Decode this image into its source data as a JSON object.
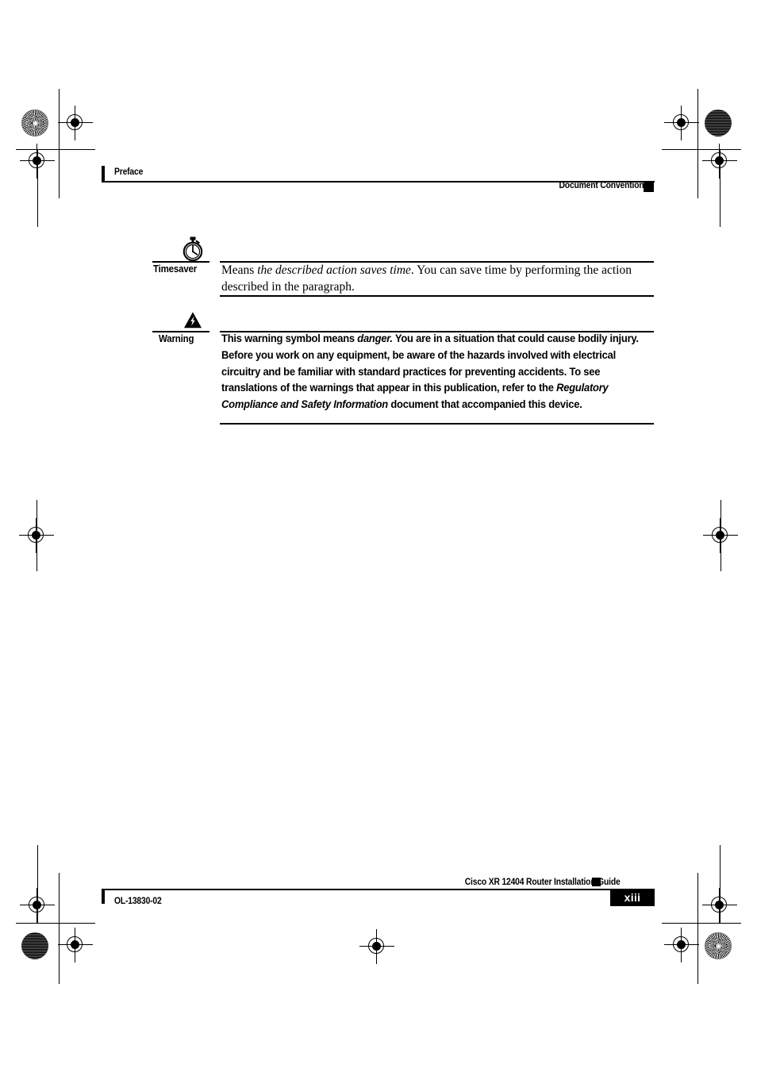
{
  "header": {
    "left_label": "Preface",
    "right_label": "Document Conventions"
  },
  "notes": [
    {
      "icon": "stopwatch-icon",
      "label": "Timesaver",
      "body_html": "Means <em>the described action saves time</em>. You can save time by performing the action described in the paragraph."
    },
    {
      "icon": "warning-triangle-icon",
      "label": "Warning",
      "body_html": "This warning symbol means <em>danger.</em> You are in a situation that could cause bodily injury. Before you work on any equipment, be aware of the hazards involved with electrical circuitry and be familiar with standard practices for preventing accidents. To see translations of the warnings that appear in this publication, refer to the <em>Regulatory Compliance and Safety Information</em> document that accompanied this device."
    }
  ],
  "footer": {
    "guide_title": "Cisco XR 12404 Router Installation Guide",
    "doc_id": "OL-13830-02",
    "page_number": "xiii"
  },
  "colors": {
    "ink": "#000000",
    "paper": "#ffffff"
  }
}
